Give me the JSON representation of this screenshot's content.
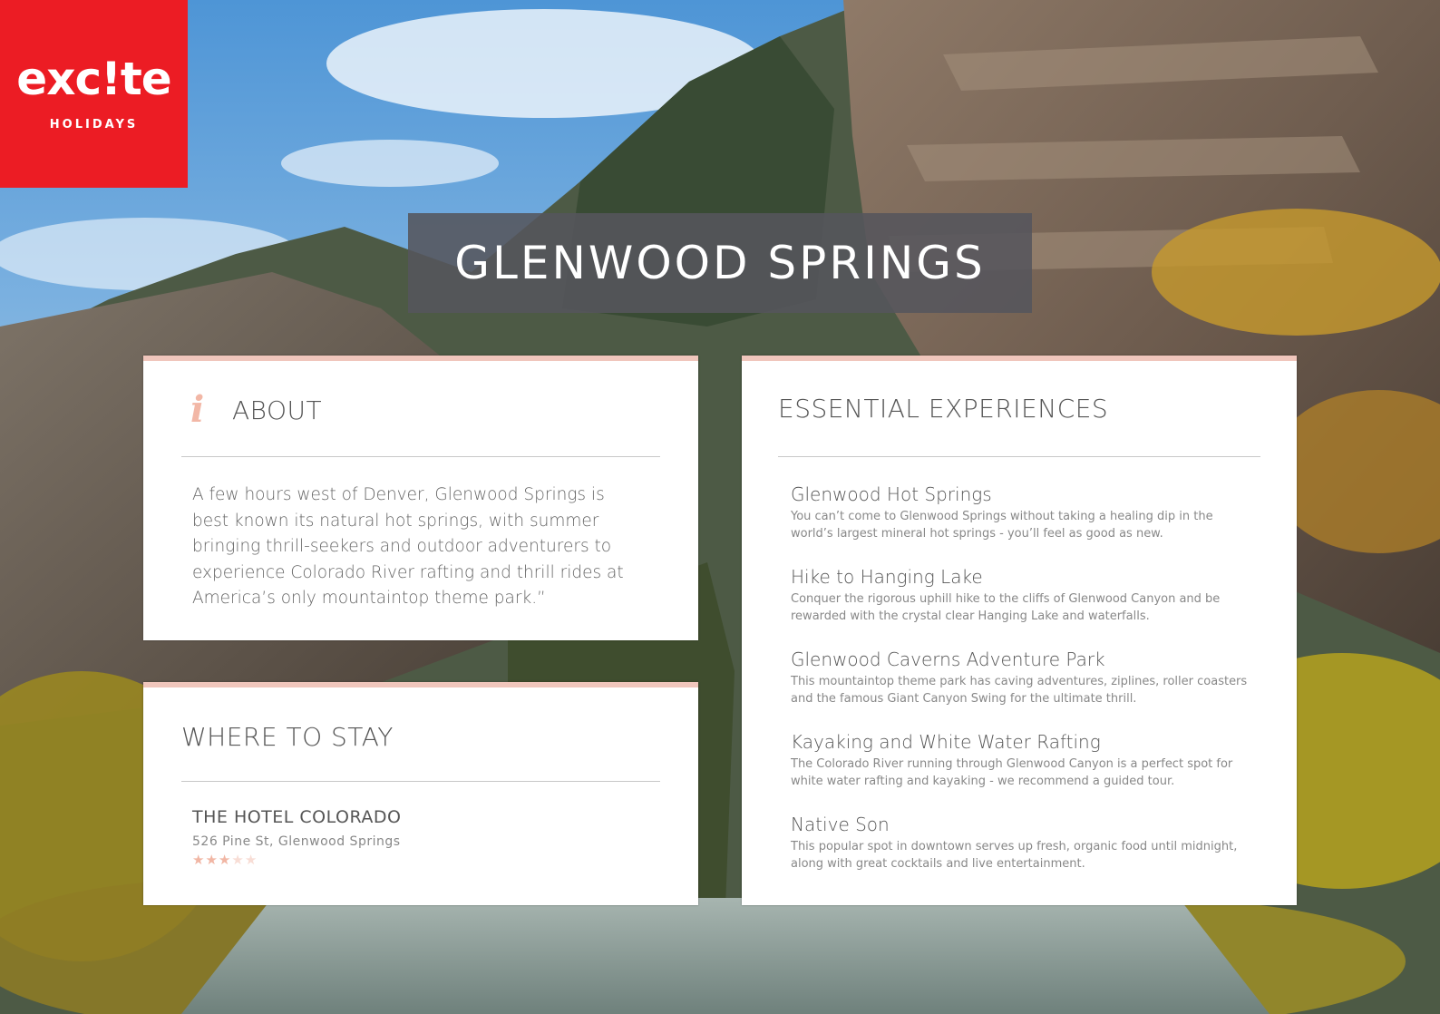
{
  "logo": {
    "wordmark": "exc!te",
    "subtitle": "HOLIDAYS",
    "brand_color": "#ec1c24"
  },
  "page_title": "GLENWOOD SPRINGS",
  "about": {
    "icon": "info-icon",
    "icon_glyph": "i",
    "heading": "ABOUT",
    "text": "A few hours west of Denver, Glenwood Springs is best known its natural hot springs, with summer bringing thrill-seekers and outdoor adventurers to experience Colorado River rafting and thrill rides at America’s only mountaintop theme park.”"
  },
  "where_to_stay": {
    "heading": "WHERE TO STAY",
    "hotel": {
      "name": "THE HOTEL COLORADO",
      "address": "526 Pine St, Glenwood Springs",
      "rating": 3,
      "rating_max": 5
    }
  },
  "experiences": {
    "heading": "ESSENTIAL EXPERIENCES",
    "items": [
      {
        "name": "Glenwood Hot Springs",
        "description": "You can’t come to Glenwood Springs without taking a healing dip in the world’s largest mineral hot springs - you’ll feel as good as new."
      },
      {
        "name": "Hike to Hanging Lake",
        "description": "Conquer the rigorous uphill hike to the cliffs of Glenwood Canyon and be rewarded with the crystal clear Hanging Lake and waterfalls."
      },
      {
        "name": "Glenwood Caverns Adventure Park",
        "description": "This mountaintop theme park has caving adventures, ziplines, roller coasters and the famous Giant Canyon Swing for the ultimate thrill."
      },
      {
        "name": "Kayaking and White Water Rafting",
        "description": "The Colorado River running through Glenwood Canyon is a perfect spot for white water rafting and kayaking - we recommend a guided tour."
      },
      {
        "name": "Native Son",
        "description": "This popular spot in downtown serves up fresh, organic food until midnight, along with great cocktails and live entertainment."
      }
    ]
  },
  "colors": {
    "accent": "#f0c6bc",
    "star_filled": "#f1b6a4",
    "star_empty": "#f8ddd5",
    "banner": "#55555c"
  }
}
